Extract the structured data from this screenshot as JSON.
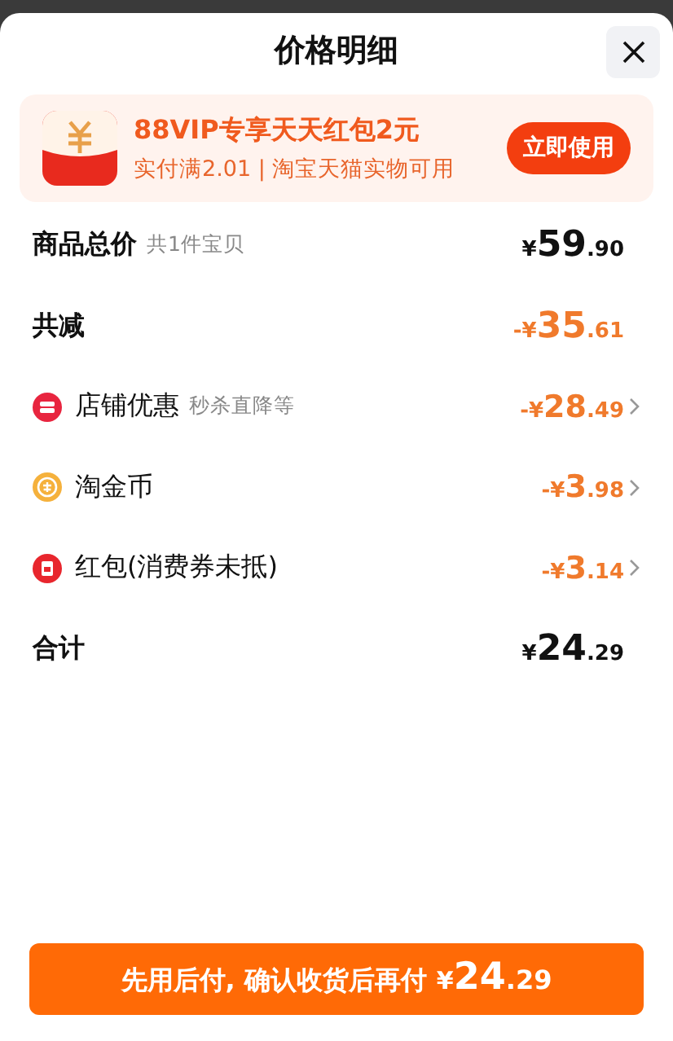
{
  "sheet": {
    "title": "价格明细"
  },
  "promo": {
    "title": "88VIP专享天天红包2元",
    "subtitle": "实付满2.01 | 淘宝天猫实物可用",
    "button": "立即使用"
  },
  "rows": [
    {
      "kind": "total",
      "label": "商品总价",
      "note": "共1件宝贝",
      "amount": "¥59.90"
    },
    {
      "kind": "discount",
      "label": "共减",
      "amount": "-¥35.61"
    },
    {
      "kind": "shop",
      "label": "店铺优惠",
      "note": "秒杀直降等",
      "amount": "-¥28.49"
    },
    {
      "kind": "coin",
      "label": "淘金币",
      "amount": "-¥3.98"
    },
    {
      "kind": "packet",
      "label": "红包(消费券未抵)",
      "amount": "-¥3.14"
    },
    {
      "kind": "total",
      "label": "合计",
      "amount": "¥24.29"
    }
  ],
  "pay_button": {
    "label": "先用后付, 确认收货后再付",
    "amount": "¥24.29"
  }
}
